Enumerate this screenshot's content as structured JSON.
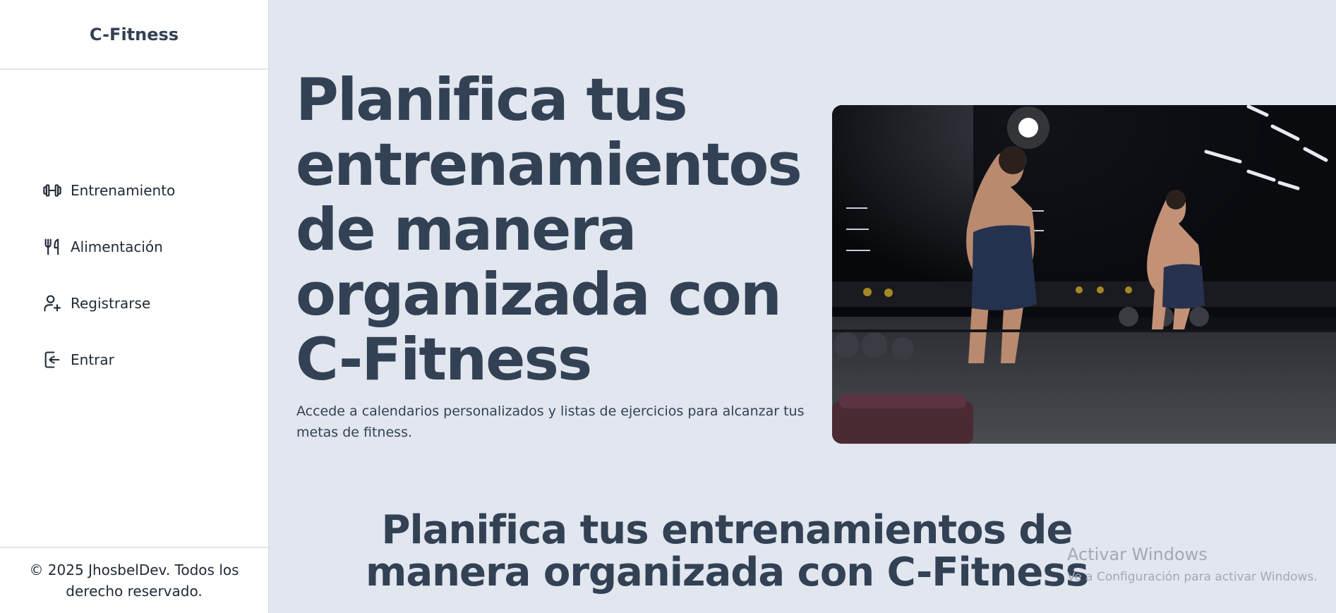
{
  "sidebar": {
    "brand": "C-Fitness",
    "items": [
      {
        "label": "Entrenamiento",
        "icon": "dumbbell-icon"
      },
      {
        "label": "Alimentación",
        "icon": "utensils-icon"
      },
      {
        "label": "Registrarse",
        "icon": "user-plus-icon"
      },
      {
        "label": "Entrar",
        "icon": "login-icon"
      }
    ],
    "footer": "© 2025 JhosbelDev. Todos los derecho reservado."
  },
  "hero": {
    "title": "Planifica tus entrenamientos de manera organizada con C-Fitness",
    "subtitle": "Accede a calendarios personalizados y listas de ejercicios para alcanzar tus metas de fitness.",
    "image": "gym-photo"
  },
  "section": {
    "title": "Planifica tus entrenamientos de manera organizada con C-Fitness"
  },
  "watermark": {
    "line1": "Activar Windows",
    "line2": "Ve a Configuración para activar Windows."
  },
  "colors": {
    "background": "#e1e6ef",
    "sidebar": "#ffffff",
    "text": "#334155"
  }
}
